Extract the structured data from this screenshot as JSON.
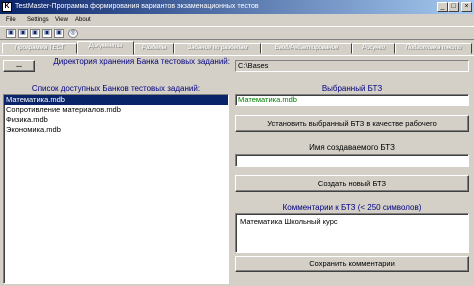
{
  "window": {
    "title": "TestMaster-Программа формирования вариантов экзаменационных тестов",
    "app_icon": "K",
    "controls": {
      "minimize": "_",
      "maximize": "□",
      "close": "×"
    }
  },
  "menu": {
    "items": [
      "File",
      "Settings",
      "View",
      "About"
    ]
  },
  "toolbar": {
    "tools": [
      "tool-1-icon",
      "tool-2-icon",
      "tool-3-icon",
      "tool-4-icon",
      "tool-5-icon",
      "tool-6-icon"
    ]
  },
  "tabs": [
    {
      "label": "Программа ТЕСТ",
      "active": false
    },
    {
      "label": "Документы",
      "active": true
    },
    {
      "label": "Разделы",
      "active": false
    },
    {
      "label": "Задания по разделам",
      "active": false
    },
    {
      "label": "Ввод/Редактирование",
      "active": false
    },
    {
      "label": "Рисунки",
      "active": false
    },
    {
      "label": "Подготовка тести",
      "active": false
    }
  ],
  "left": {
    "browse_label": "...",
    "dir_label": "Директория хранения Банка тестовых заданий:",
    "list_title": "Список доступных Банков тестовых заданий:",
    "banks": [
      {
        "name": "Математика.mdb",
        "selected": true
      },
      {
        "name": "Сопротивление материалов.mdb",
        "selected": false
      },
      {
        "name": "Физика.mdb",
        "selected": false
      },
      {
        "name": "Экономика.mdb",
        "selected": false
      }
    ]
  },
  "right": {
    "dir_value": "C:\\Bases",
    "selected_title": "Выбранный БТЗ",
    "selected_value": "Математика.mdb",
    "set_working_label": "Установить выбранный БТЗ в качестве рабочего",
    "new_name_title": "Имя создаваемого БТЗ",
    "new_name_value": "",
    "create_label": "Создать новый БТЗ",
    "comments_title": "Комментарии к БТЗ  (< 250 символов)",
    "comments_value": "Математика Школьный курс",
    "save_label": "Сохранить комментарии"
  },
  "colors": {
    "title_start": "#0a246a",
    "title_end": "#a6caf0",
    "selection": "#0a246a",
    "label_blue": "#000080",
    "selected_bank_text": "#008000"
  }
}
